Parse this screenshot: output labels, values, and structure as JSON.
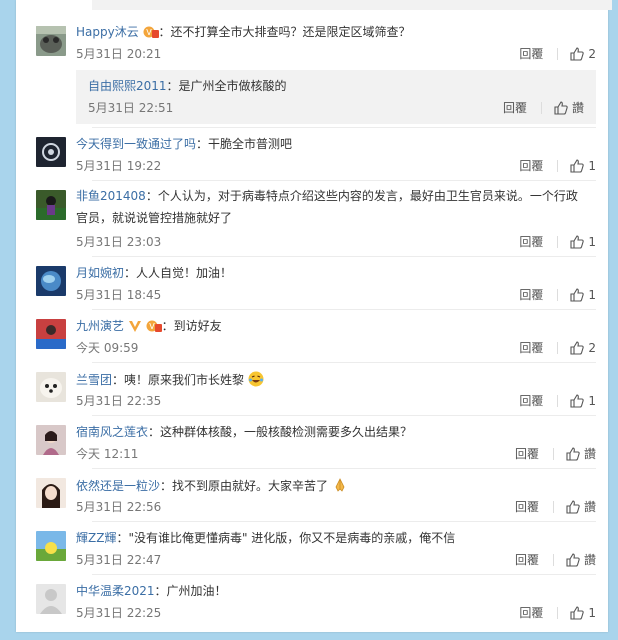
{
  "comments": [
    {
      "name": "Happy沐云",
      "badges": [
        "vip-badge"
      ],
      "text": "：还不打算全市大排查吗？还是限定区域筛查？",
      "time": "5月31日 20:21",
      "reply": "回覆",
      "likes": "2"
    },
    {
      "name": "今天得到一致通过了吗",
      "text": "：干脆全市普测吧",
      "time": "5月31日 19:22",
      "reply": "回覆",
      "likes": "1"
    },
    {
      "name": "非鱼201408",
      "text": "：个人认为，对于病毒特点介绍这些内容的发言，最好由卫生官员来说。一个行政官员，就说说管控措施就好了",
      "time": "5月31日 23:03",
      "reply": "回覆",
      "likes": "1"
    },
    {
      "name": "月如婉初",
      "text": "：人人自觉！加油！",
      "time": "5月31日 18:45",
      "reply": "回覆",
      "likes": "1"
    },
    {
      "name": "九州演艺",
      "badges": [
        "verified-v-badge",
        "vip-badge"
      ],
      "text": "：到访好友",
      "time": "今天 09:59",
      "reply": "回覆",
      "likes": "2"
    },
    {
      "name": "兰雪团",
      "text": "：咦！原来我们市长姓黎",
      "emoji": "laughing-emoji",
      "time": "5月31日 22:35",
      "reply": "回覆",
      "likes": "1"
    },
    {
      "name": "宿南风之莲衣",
      "text": "：这种群体核酸，一般核酸检测需要多久出结果？",
      "time": "今天 12:11",
      "reply": "回覆",
      "likes": "讚"
    },
    {
      "name": "依然还是一粒沙",
      "text": "：找不到原由就好。大家辛苦了",
      "emoji": "praying-hands-emoji",
      "time": "5月31日 22:56",
      "reply": "回覆",
      "likes": "讚"
    },
    {
      "name": "輝ZZ輝",
      "text": "：\"没有谁比俺更懂病毒\" 进化版，你又不是病毒的亲戚，俺不信",
      "time": "5月31日 22:47",
      "reply": "回覆",
      "likes": "讚"
    },
    {
      "name": "中华温柔2021",
      "text": "：广州加油！",
      "time": "5月31日 22:25",
      "reply": "回覆",
      "likes": "1"
    }
  ],
  "sub_reply": {
    "name": "自由熙熙2011",
    "text": "：是广州全市做核酸的",
    "time": "5月31日 22:51",
    "reply": "回覆",
    "likes": "讚"
  }
}
